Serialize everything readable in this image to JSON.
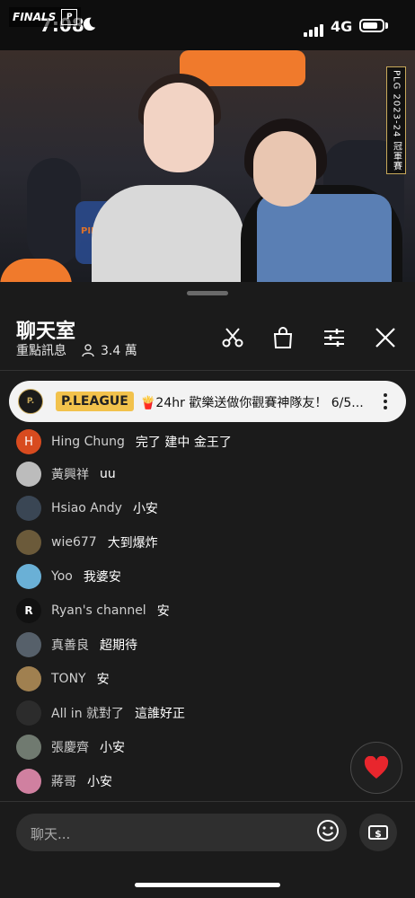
{
  "status_bar": {
    "time": "7:08",
    "network": "4G"
  },
  "video": {
    "overlay_title": "FINALS",
    "overlay_badge": "P",
    "side_tag": "PLG 2023-24 冠軍賽",
    "jersey_text": "PILOTS"
  },
  "chat": {
    "title": "聊天室",
    "subtitle": "重點訊息",
    "viewer_count": "3.4 萬",
    "pinned": {
      "avatar": "P.",
      "author": "P.LEAGUE",
      "message": "🍟24hr 歡樂送做你觀賽神隊友！ 6/5..."
    },
    "messages": [
      {
        "author": "Hing Chung",
        "text": "完了 建中 金王了",
        "avatar_letter": "H",
        "avatar_color": "#d84b1f"
      },
      {
        "author": "黃興祥",
        "text": "uu",
        "avatar_letter": "",
        "avatar_color": "#bcbcbc"
      },
      {
        "author": "Hsiao Andy",
        "text": "小安",
        "avatar_letter": "",
        "avatar_color": "#3a4654"
      },
      {
        "author": "wie677",
        "text": "大到爆炸",
        "avatar_letter": "",
        "avatar_color": "#6b5a3a"
      },
      {
        "author": "Yoo",
        "text": "我婆安",
        "avatar_letter": "",
        "avatar_color": "#6ab0d6"
      },
      {
        "author": "Ryan's channel",
        "text": "安",
        "avatar_letter": "R",
        "avatar_color": "#111111"
      },
      {
        "author": "真善良",
        "text": "超期待",
        "avatar_letter": "",
        "avatar_color": "#56606a"
      },
      {
        "author": "TONY",
        "text": "安",
        "avatar_letter": "",
        "avatar_color": "#a08050"
      },
      {
        "author": "All in 就對了",
        "text": "這誰好正",
        "avatar_letter": "",
        "avatar_color": "#2c2c2c"
      },
      {
        "author": "張慶齊",
        "text": "小安",
        "avatar_letter": "",
        "avatar_color": "#707a70"
      },
      {
        "author": "蔣哥",
        "text": "小安",
        "avatar_letter": "",
        "avatar_color": "#d080a0"
      }
    ],
    "input_placeholder": "聊天..."
  },
  "icons": {
    "moon": "moon-icon",
    "people": "people-icon",
    "clip": "scissors-icon",
    "shop": "shopping-bag-icon",
    "settings": "sliders-icon",
    "close": "close-icon",
    "more": "more-vertical-icon",
    "heart": "heart-icon",
    "emoji": "emoji-icon",
    "money": "super-chat-icon"
  },
  "colors": {
    "background": "#1b1b1b",
    "pinned_bg": "#f3f3f3",
    "pinned_name_bg": "#f2c24c",
    "heart": "#e8262d"
  }
}
